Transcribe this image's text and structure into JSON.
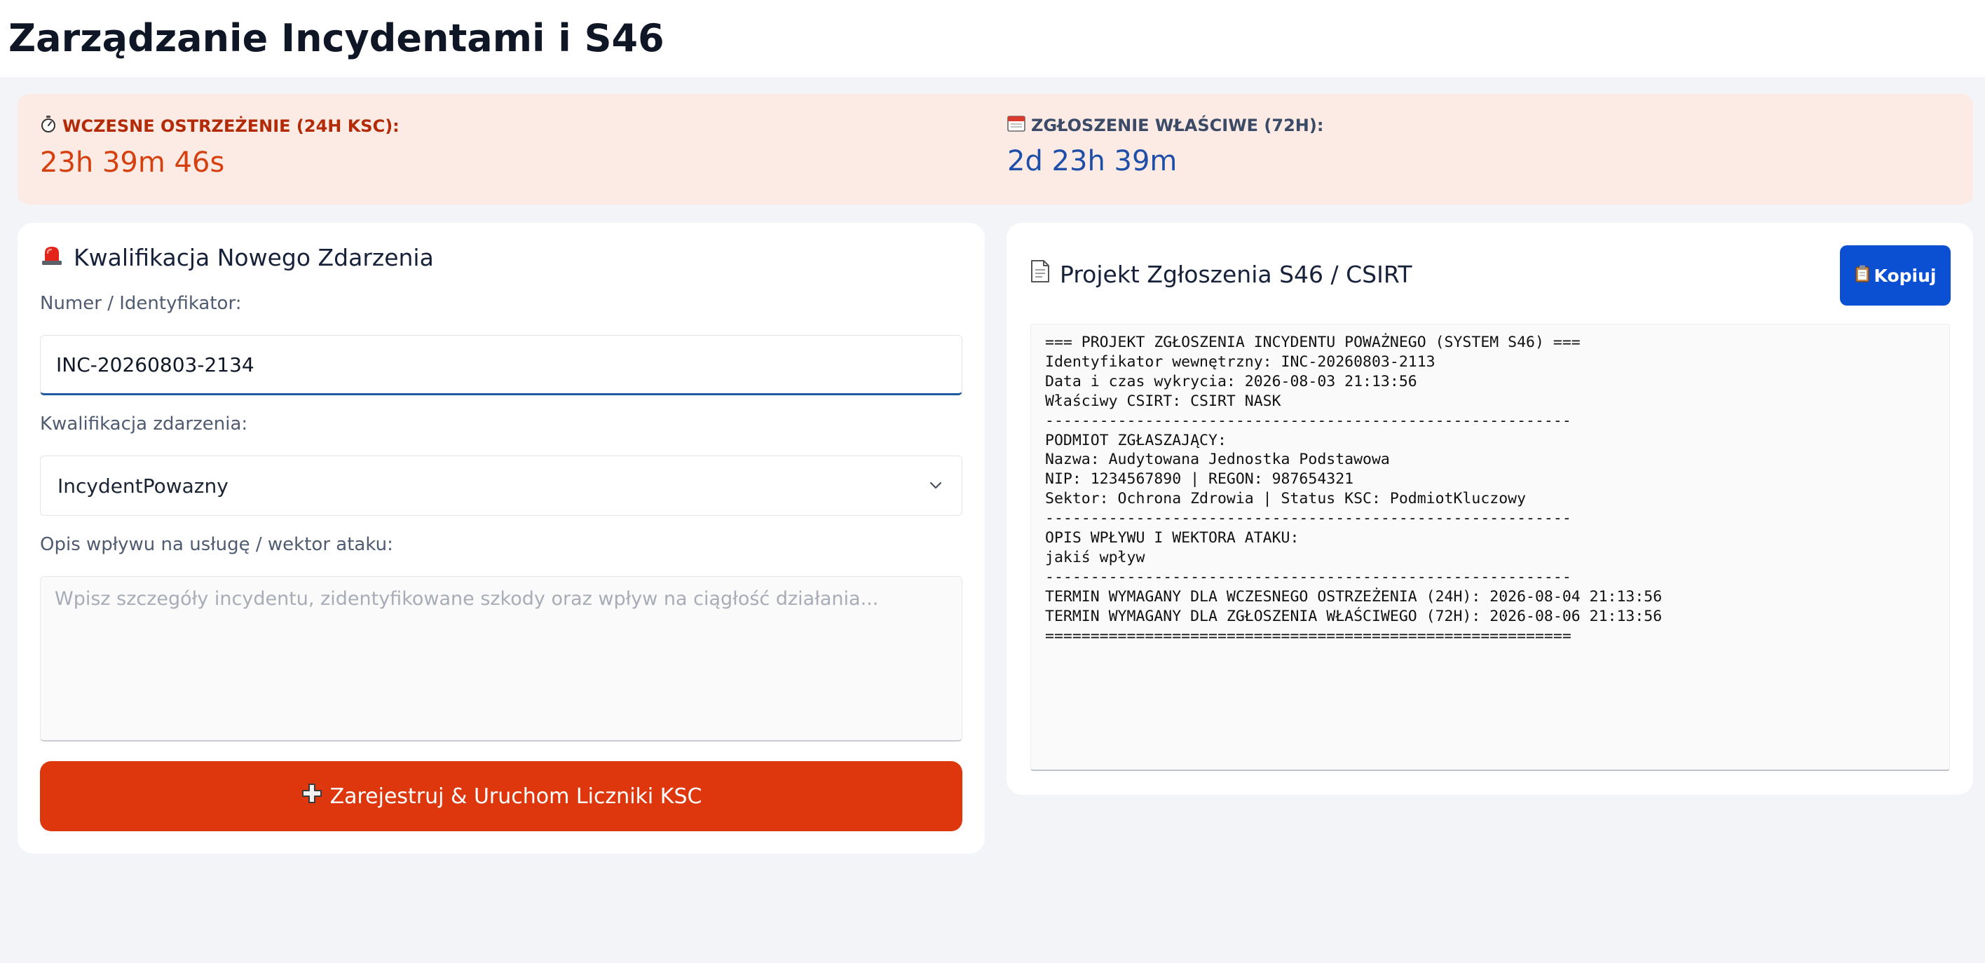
{
  "header": {
    "title": "Zarządzanie Incydentami i S46"
  },
  "deadlines": {
    "early": {
      "icon": "stopwatch-icon",
      "label": "WCZESNE OSTRZEŻENIE (24H KSC):",
      "value": "23h 39m 46s",
      "color": "#d6400f"
    },
    "proper": {
      "icon": "calendar-icon",
      "label": "ZGŁOSZENIE WŁAŚCIWE (72H):",
      "value": "2d 23h 39m",
      "color": "#1d4ea8"
    }
  },
  "qualification": {
    "icon": "siren-icon",
    "title": "Kwalifikacja Nowego Zdarzenia",
    "id_label": "Numer / Identyfikator:",
    "id_value": "INC-20260803-2134",
    "classification_label": "Kwalifikacja zdarzenia:",
    "classification_value": "IncydentPowazny",
    "description_label": "Opis wpływu na usługę / wektor ataku:",
    "description_placeholder": "Wpisz szczegóły incydentu, zidentyfikowane szkody oraz wpływ na ciągłość działania...",
    "description_value": "",
    "submit_label": "Zarejestruj & Uruchom Liczniki KSC",
    "submit_icon": "plus-icon",
    "submit_color": "#de370d"
  },
  "report": {
    "icon": "document-icon",
    "title": "Projekt Zgłoszenia S46 / CSIRT",
    "copy_label": "Kopiuj",
    "copy_icon": "clipboard-icon",
    "copy_color": "#0b50d3",
    "text": "=== PROJEKT ZGŁOSZENIA INCYDENTU POWAŻNEGO (SYSTEM S46) ===\nIdentyfikator wewnętrzny: INC-20260803-2113\nData i czas wykrycia: 2026-08-03 21:13:56\nWłaściwy CSIRT: CSIRT NASK\n----------------------------------------------------------\nPODMIOT ZGŁASZAJĄCY:\nNazwa: Audytowana Jednostka Podstawowa\nNIP: 1234567890 | REGON: 987654321\nSektor: Ochrona Zdrowia | Status KSC: PodmiotKluczowy\n----------------------------------------------------------\nOPIS WPŁYWU I WEKTORA ATAKU:\njakiś wpływ\n----------------------------------------------------------\nTERMIN WYMAGANY DLA WCZESNEGO OSTRZEŻENIA (24H): 2026-08-04 21:13:56\nTERMIN WYMAGANY DLA ZGŁOSZENIA WŁAŚCIWEGO (72H): 2026-08-06 21:13:56\n=========================================================="
  }
}
